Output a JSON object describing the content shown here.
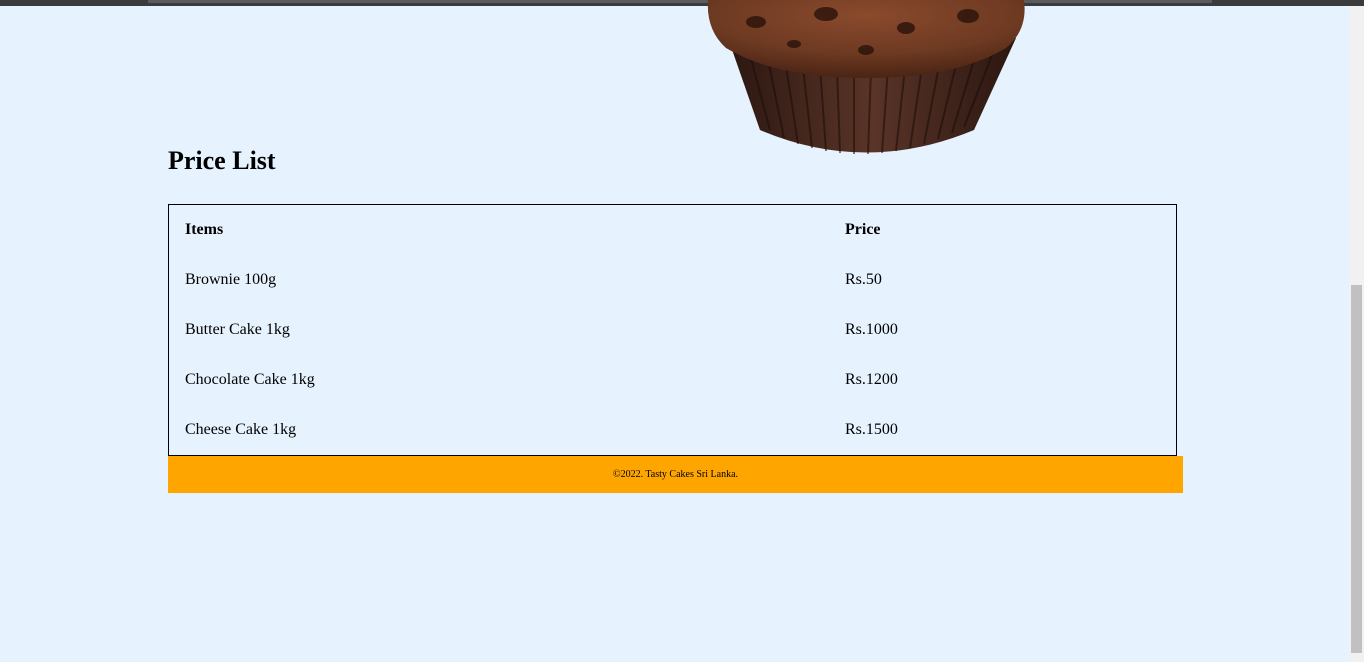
{
  "price_list": {
    "title": "Price List",
    "headers": {
      "item": "Items",
      "price": "Price"
    },
    "rows": [
      {
        "item": "Brownie 100g",
        "price": "Rs.50"
      },
      {
        "item": "Butter Cake 1kg",
        "price": "Rs.1000"
      },
      {
        "item": "Chocolate Cake 1kg",
        "price": "Rs.1200"
      },
      {
        "item": "Cheese Cake 1kg",
        "price": "Rs.1500"
      }
    ]
  },
  "footer": {
    "text": "©2022. Tasty Cakes Sri Lanka."
  },
  "colors": {
    "page_background": "#e6f2fd",
    "footer_background": "#ffa500"
  },
  "images": {
    "hero": "muffin-image"
  }
}
